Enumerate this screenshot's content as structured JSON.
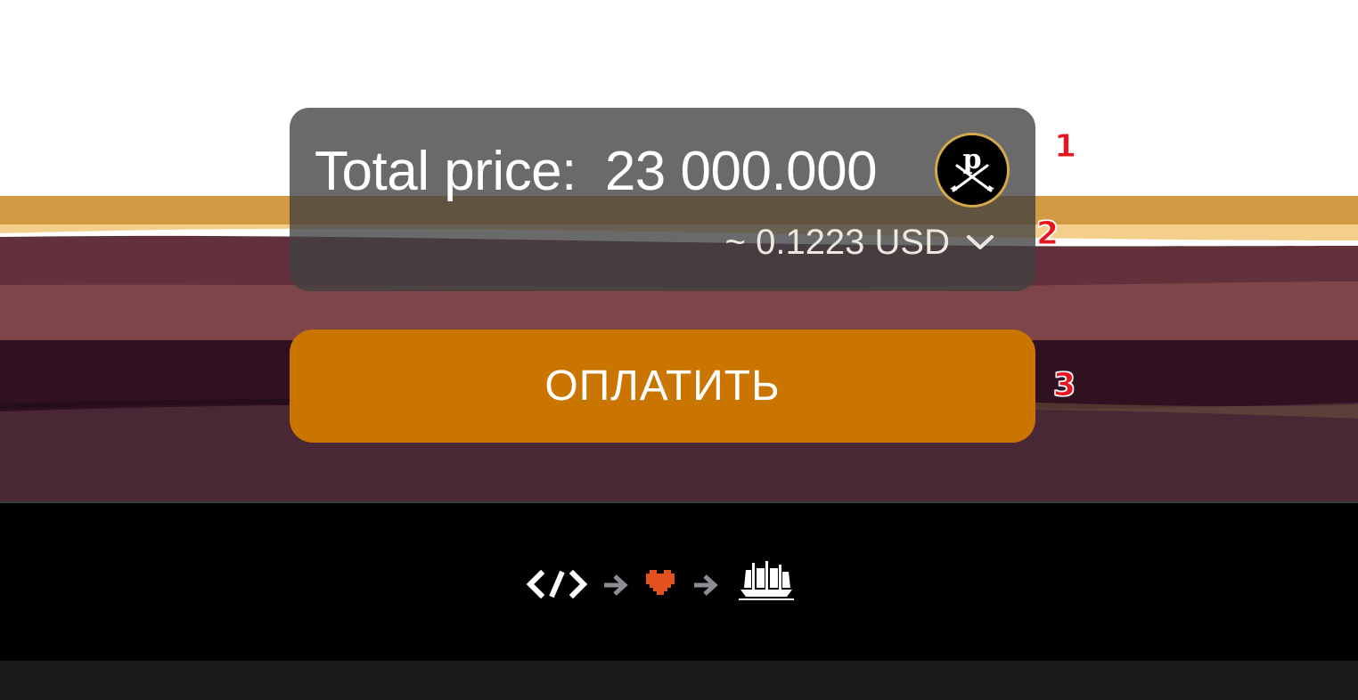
{
  "price": {
    "label": "Total price:",
    "amount": "23 000.000",
    "coin_icon": "pirate-coin-icon",
    "coin_letter": "p",
    "usd_approx": "~ 0.1223 USD",
    "dropdown_icon": "chevron-down-icon"
  },
  "pay": {
    "label": "ОПЛАТИТЬ"
  },
  "markers": {
    "one": "1",
    "two": "2",
    "three": "3"
  },
  "footer": {
    "credit_icons": [
      "code-icon",
      "arrow-right-icon",
      "heart-icon",
      "arrow-right-icon",
      "pirate-ship-icon"
    ]
  },
  "colors": {
    "accent": "#c97500",
    "heart": "#e4501e",
    "coin_ring": "#d4a94a"
  }
}
